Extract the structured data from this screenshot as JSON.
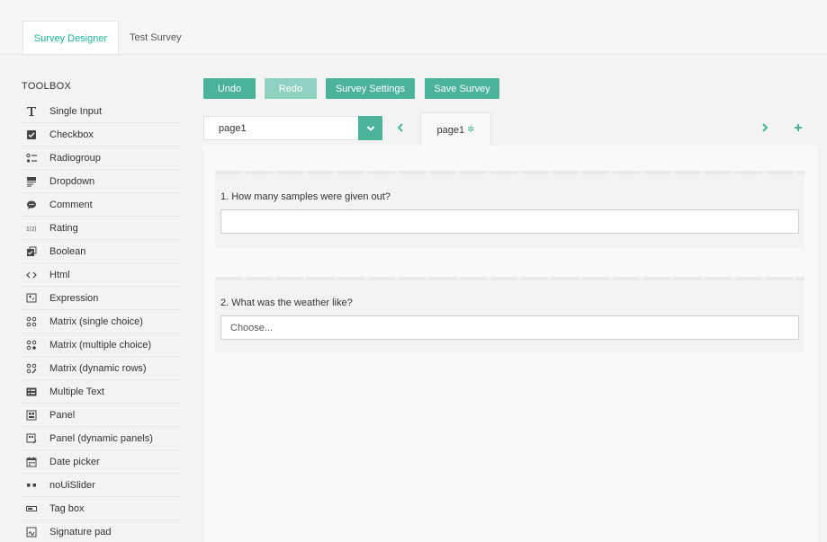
{
  "tabs": [
    {
      "label": "Survey Designer",
      "active": true
    },
    {
      "label": "Test Survey",
      "active": false
    }
  ],
  "toolbox": {
    "title": "TOOLBOX",
    "items": [
      {
        "label": "Single Input",
        "icon": "text-t-icon"
      },
      {
        "label": "Checkbox",
        "icon": "checkbox-icon"
      },
      {
        "label": "Radiogroup",
        "icon": "radiogroup-icon"
      },
      {
        "label": "Dropdown",
        "icon": "dropdown-icon"
      },
      {
        "label": "Comment",
        "icon": "comment-bubble-icon"
      },
      {
        "label": "Rating",
        "icon": "rating-icon"
      },
      {
        "label": "Boolean",
        "icon": "boolean-icon"
      },
      {
        "label": "Html",
        "icon": "code-brackets-icon"
      },
      {
        "label": "Expression",
        "icon": "expression-icon"
      },
      {
        "label": "Matrix (single choice)",
        "icon": "matrix-single-icon"
      },
      {
        "label": "Matrix (multiple choice)",
        "icon": "matrix-multiple-icon"
      },
      {
        "label": "Matrix (dynamic rows)",
        "icon": "matrix-dynamic-icon"
      },
      {
        "label": "Multiple Text",
        "icon": "multiple-text-icon"
      },
      {
        "label": "Panel",
        "icon": "panel-icon"
      },
      {
        "label": "Panel (dynamic panels)",
        "icon": "panel-dynamic-icon"
      },
      {
        "label": "Date picker",
        "icon": "calendar-icon"
      },
      {
        "label": "noUiSlider",
        "icon": "slider-icon"
      },
      {
        "label": "Tag box",
        "icon": "tagbox-icon"
      },
      {
        "label": "Signature pad",
        "icon": "signature-icon"
      }
    ]
  },
  "toolbar": {
    "undo": "Undo",
    "redo": "Redo",
    "settings": "Survey Settings",
    "save": "Save Survey"
  },
  "pages": {
    "selected": "page1",
    "tab_label": "page1"
  },
  "questions": [
    {
      "title": "1. How many samples were given out?",
      "type": "text",
      "value": ""
    },
    {
      "title": "2. What was the weather like?",
      "type": "dropdown",
      "placeholder": "Choose..."
    }
  ],
  "colors": {
    "accent": "#4cb39b",
    "accent_disabled": "#8fd1c0",
    "active_tab_text": "#1ab394"
  }
}
